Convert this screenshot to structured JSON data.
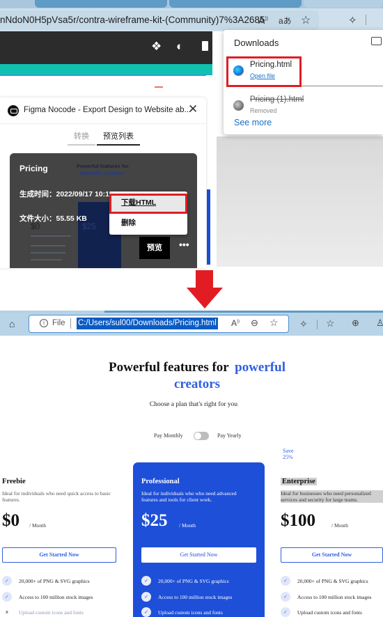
{
  "top_browser": {
    "address_url": "nNdoN0H5pVsa5r/contra-wireframe-kit-(Community)7%3A2685",
    "icons": [
      "read-aloud-icon",
      "translate-icon",
      "add-favorite-icon",
      "extensions-icon"
    ]
  },
  "figma_toolbar": {
    "icons": [
      "components-icon",
      "theme-toggle-icon",
      "panel-icon"
    ]
  },
  "plugin": {
    "title": "Figma Nocode - Export Design to Website ab...",
    "tabs": [
      {
        "label": "转换",
        "active": false
      },
      {
        "label": "预览列表",
        "active": true
      }
    ],
    "card": {
      "name": "Pricing",
      "thumb_title": "Powerful features for",
      "thumb_title_accent": "powerful creators",
      "thumb_price_free": "$0",
      "thumb_price_pro": "$25",
      "generated_time": "生成时间：2022/09/17 10:17",
      "file_size": "文件大小：55.55 KB",
      "preview_label": "预览",
      "more_label": "•••"
    },
    "context_menu": [
      {
        "label": "下载HTML",
        "highlighted": true
      },
      {
        "label": "删除",
        "highlighted": false
      }
    ]
  },
  "downloads": {
    "title": "Downloads",
    "items": [
      {
        "name": "Pricing.html",
        "sub": "Open file",
        "removed": false
      },
      {
        "name": "Pricing (1).html",
        "sub": "Removed",
        "removed": true
      }
    ],
    "see_more": "See more"
  },
  "bottom_browser": {
    "file_label": "File",
    "info_glyph": "i",
    "url": "C:/Users/sul00/Downloads/Pricing.html"
  },
  "pricing_page": {
    "title": "Powerful features for",
    "title_accent": "powerful creators",
    "subtitle": "Choose a plan that's right for you",
    "pay_monthly": "Pay Monthly",
    "pay_yearly": "Pay Yearly",
    "save_line1": "Save",
    "save_line2": "25%",
    "plans": [
      {
        "name": "Freebie",
        "description": "Ideal for individuals who need quick access to basic features.",
        "price": "$0",
        "period": "/ Month",
        "button": "Get Started Now",
        "features": [
          {
            "text": "20,000+ of PNG & SVG graphics",
            "included": true
          },
          {
            "text": "Access to 100 million stock images",
            "included": true
          },
          {
            "text": "Upload custom icons and fonts",
            "included": false
          }
        ]
      },
      {
        "name": "Professional",
        "description": "Ideal for individuals who who need advanced features and tools for client work.",
        "price": "$25",
        "period": "/ Month",
        "button": "Get Started Now",
        "features": [
          {
            "text": "20,000+ of PNG & SVG graphics",
            "included": true
          },
          {
            "text": "Access to 100 million stock images",
            "included": true
          },
          {
            "text": "Upload custom icons and fonts",
            "included": true
          }
        ]
      },
      {
        "name": "Enterprise",
        "description": "Ideal for businesses who need personalized services and security for large teams.",
        "price": "$100",
        "period": "/ Month",
        "button": "Get Started Now",
        "features": [
          {
            "text": "20,000+ of PNG & SVG graphics",
            "included": true
          },
          {
            "text": "Access to 100 million stock images",
            "included": true
          },
          {
            "text": "Upload custom icons and fonts",
            "included": true
          }
        ]
      }
    ]
  },
  "colors": {
    "accent_blue": "#2f5fe0",
    "pro_card_blue": "#1e4fd8",
    "highlight_red": "#e11d23",
    "teal": "#0fc1ae"
  }
}
